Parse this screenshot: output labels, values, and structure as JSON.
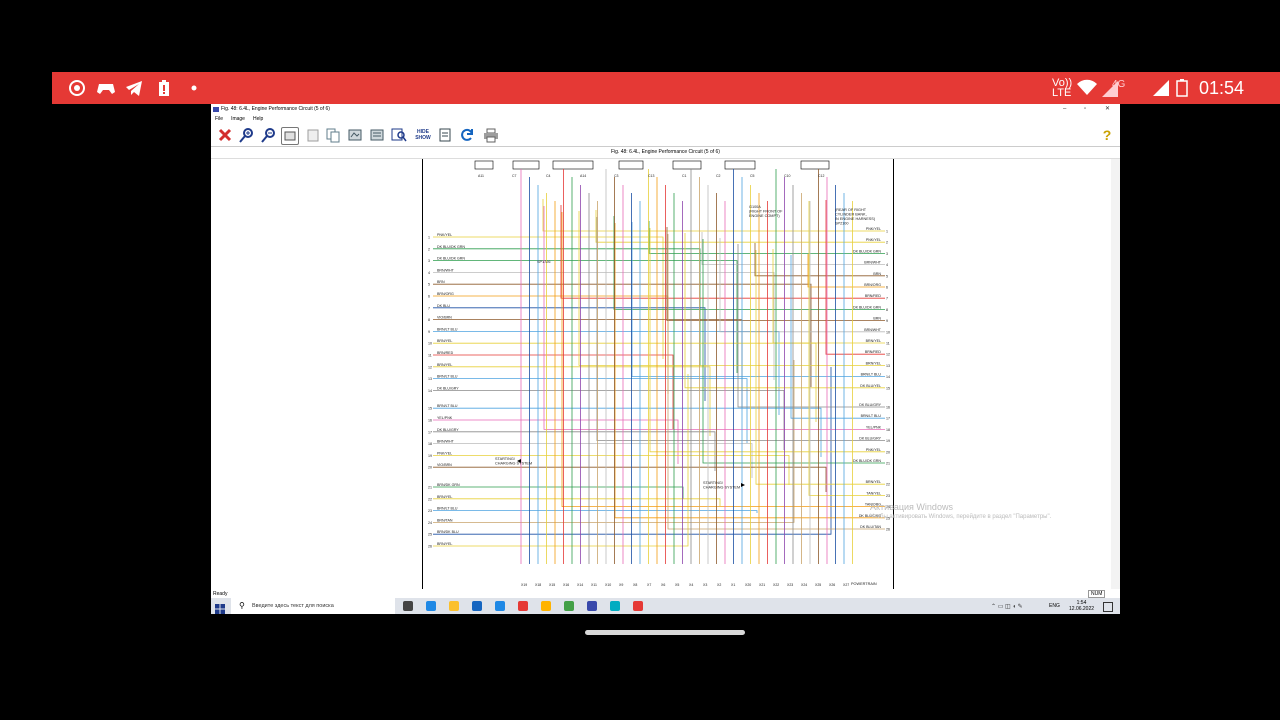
{
  "statusbar": {
    "time": "01:54",
    "network_top": "Vo))",
    "network_bottom": "LTE",
    "signal_label": "4G",
    "left_icons": [
      "record-icon",
      "gamepad-icon",
      "telegram-icon",
      "battery-saver-icon",
      "dot-icon"
    ]
  },
  "window": {
    "title": "Fig. 48: 6.4L, Engine Performance Circuit (5 of 6)",
    "minimize": "–",
    "maximize": "▫",
    "close": "✕",
    "menu": [
      "File",
      "Image",
      "Help"
    ],
    "caption": "Fig. 48: 6.4L, Engine Performance Circuit (5 of 6)",
    "status": "Ready",
    "status_right": "NUM"
  },
  "toolbar": {
    "buttons": [
      {
        "name": "close-image-button",
        "color": "#d32f2f"
      },
      {
        "name": "zoom-in-button",
        "color": "#1e3a8a"
      },
      {
        "name": "zoom-out-button",
        "color": "#1e3a8a"
      },
      {
        "name": "fit-button",
        "color": "#555555"
      },
      {
        "name": "print-preview-button",
        "color": "#9e9e9e"
      },
      {
        "name": "copy-button",
        "color": "#607d8b"
      },
      {
        "name": "figure-button",
        "color": "#455a64"
      },
      {
        "name": "figure2-button",
        "color": "#455a64"
      },
      {
        "name": "find-button",
        "color": "#1e3a8a"
      },
      {
        "name": "hide-show-button",
        "color": "#1e3a8a"
      },
      {
        "name": "notes-button",
        "color": "#37474f"
      },
      {
        "name": "refresh-button",
        "color": "#1565c0"
      },
      {
        "name": "print-button",
        "color": "#616161"
      }
    ],
    "hide_show_top": "HIDE",
    "hide_show_bottom": "SHOW",
    "help": "?"
  },
  "diagram": {
    "left_labels": [
      "PNK/YEL",
      "DK BLU/DK GRN",
      "DK BLU/DK GRN",
      "BRN/WHT",
      "BRN",
      "BRN/ORG",
      "DK BLU",
      "VIO/BRN",
      "BRN/LT BLU",
      "BRN/YEL",
      "BRN/RED",
      "BRN/YEL",
      "BRN/LT BLU",
      "DK BLU/GRY",
      "BRN/LT BLU",
      "YEL/PNK",
      "DK BLU/GRY",
      "BRN/WHT",
      "PNK/YEL",
      "VIO/BRN",
      "BRN/DK GRN",
      "BRN/YEL",
      "BRN/LT BLU",
      "BRN/TAN",
      "BRN/DK BLU",
      "BRN/YEL"
    ],
    "left_numbers": [
      "1",
      "2",
      "3",
      "4",
      "5",
      "6",
      "7",
      "8",
      "9",
      "10",
      "11",
      "12",
      "13",
      "14",
      "15",
      "16",
      "17",
      "18",
      "19",
      "20",
      "21",
      "22",
      "23",
      "24",
      "25",
      "26"
    ],
    "right_labels": [
      "PNK/YEL",
      "PNK/YEL",
      "DK BLU/DK GRN",
      "BRN/WHT",
      "BRN",
      "BRN/ORG",
      "BRN/RED",
      "DK BLU/DK GRN",
      "BRN",
      "BRN/WHT",
      "BRN/YEL",
      "BRN/RED",
      "BRN/YEL",
      "BRN/LT BLU",
      "DK BLU/YEL",
      "DK BLU/GRY",
      "BRN/LT BLU",
      "YEL/PNK",
      "DK BLU/GRY",
      "PNK/YEL",
      "DK BLU/DK GRN",
      "BRN/YEL",
      "TAN/YEL",
      "TAN/ORG",
      "DK BLU/ORG",
      "DK BLU/TAN"
    ],
    "right_numbers": [
      "1",
      "2",
      "3",
      "4",
      "5",
      "6",
      "7",
      "8",
      "9",
      "10",
      "11",
      "12",
      "13",
      "14",
      "15",
      "16",
      "17",
      "18",
      "19",
      "20",
      "21",
      "22",
      "23",
      "24",
      "25",
      "26"
    ],
    "annotation_g": "G100A\n(RIGHT FRONT OF\nENGINE COMPT)",
    "annotation_rear": "(REAR OF RIGHT\nCYLINDER BANK,\nIN ENGINE HARNESS)\nSP2100",
    "splice": "SP1726",
    "starting_left": "STARTING/\nCHARGING SYSTEM",
    "starting_right": "STARTING/\nCHARGING SYSTEM",
    "powertrain": "POWERTRAIN",
    "top_terminals": [
      "A11",
      "C7",
      "C4",
      "A14",
      "C3",
      "C13",
      "C1",
      "C2",
      "C5",
      "C10",
      "C12"
    ],
    "bottom_terminals": [
      "X19",
      "X18",
      "X15",
      "X16",
      "X14",
      "X11",
      "X10",
      "X9",
      "X8",
      "X7",
      "X6",
      "X5",
      "X4",
      "X3",
      "X2",
      "X1",
      "X20",
      "X21",
      "X22",
      "X23",
      "X24",
      "X25",
      "X26",
      "X27"
    ]
  },
  "watermark": {
    "title": "Активация Windows",
    "subtitle": "Чтобы активировать Windows, перейдите в раздел \"Параметры\"."
  },
  "taskbar": {
    "search_placeholder": "Введите здесь текст для поиска",
    "lang": "ENG",
    "time": "1:54",
    "date": "12.06.2022",
    "apps": [
      {
        "name": "task-view-icon",
        "color": "#444444"
      },
      {
        "name": "edge-icon",
        "color": "#1e88e5"
      },
      {
        "name": "file-explorer-icon",
        "color": "#fbc02d"
      },
      {
        "name": "mail-icon",
        "color": "#1565c0"
      },
      {
        "name": "store-icon",
        "color": "#1e88e5"
      },
      {
        "name": "yandex-icon",
        "color": "#e53935"
      },
      {
        "name": "chrome-icon",
        "color": "#ffb300"
      },
      {
        "name": "green-app-icon",
        "color": "#43a047"
      },
      {
        "name": "terminal-app-icon",
        "color": "#3949ab"
      },
      {
        "name": "c-app-icon",
        "color": "#00acc1"
      },
      {
        "name": "recorder-app-icon",
        "color": "#e53935"
      }
    ]
  }
}
